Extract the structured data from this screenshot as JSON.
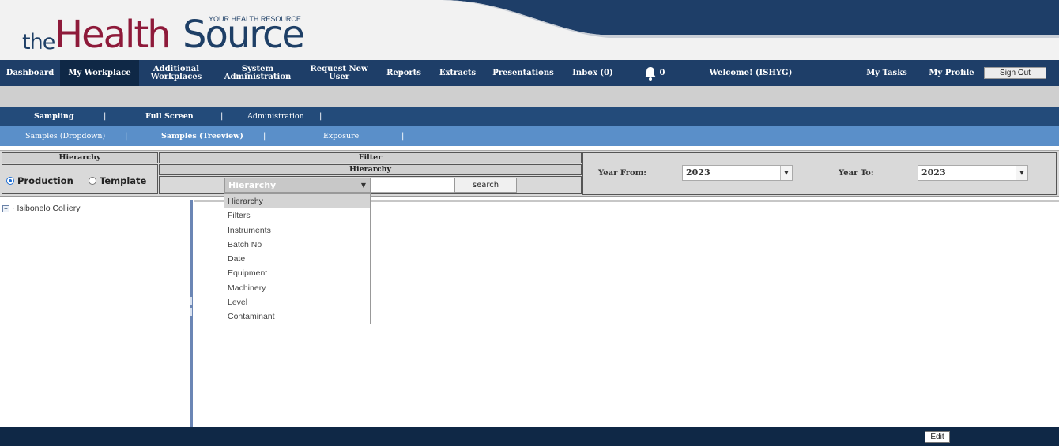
{
  "logo": {
    "prefix": "the",
    "health": "Health",
    "source": "Source",
    "tagline": "YOUR HEALTH RESOURCE"
  },
  "nav": {
    "dashboard": "Dashboard",
    "my_workplace": "My Workplace",
    "additional_1": "Additional",
    "additional_2": "Workplaces",
    "system_1": "System",
    "system_2": "Administration",
    "request_new_user": "Request New User",
    "reports": "Reports",
    "extracts": "Extracts",
    "presentations": "Presentations",
    "inbox": "Inbox (0)",
    "bell_count": "0",
    "welcome": "Welcome! (ISHYG)",
    "my_tasks": "My Tasks",
    "my_profile": "My Profile",
    "sign_out": "Sign Out"
  },
  "subnav1": {
    "sampling": "Sampling",
    "full_screen": "Full Screen",
    "administration": "Administration",
    "separator": "|"
  },
  "subnav2": {
    "samples_dropdown": "Samples (Dropdown)",
    "samples_treeview": "Samples (Treeview)",
    "exposure": "Exposure",
    "separator": "|"
  },
  "filter": {
    "hierarchy_header": "Hierarchy",
    "filter_header": "Filter",
    "filter_subheader": "Hierarchy",
    "production_label": "Production",
    "template_label": "Template",
    "production_selected": true,
    "select_value": "Hierarchy",
    "search_value": "",
    "search_button": "search"
  },
  "year": {
    "from_label": "Year From:",
    "from_value": "2023",
    "to_label": "Year To:",
    "to_value": "2023"
  },
  "tree": {
    "node_expander": "+",
    "node_label": "Isibonelo Colliery"
  },
  "dropdown": {
    "options": [
      "Hierarchy",
      "Filters",
      "Instruments",
      "Batch No",
      "Date",
      "Equipment",
      "Machinery",
      "Level",
      "Contaminant"
    ],
    "selected_index": 0
  },
  "footer": {
    "edit_button": "Edit"
  },
  "colors": {
    "navy": "#1e3e68",
    "dark_navy": "#0f2846",
    "light_blue": "#5a8fc9",
    "brand_red": "#8e1a3a"
  }
}
